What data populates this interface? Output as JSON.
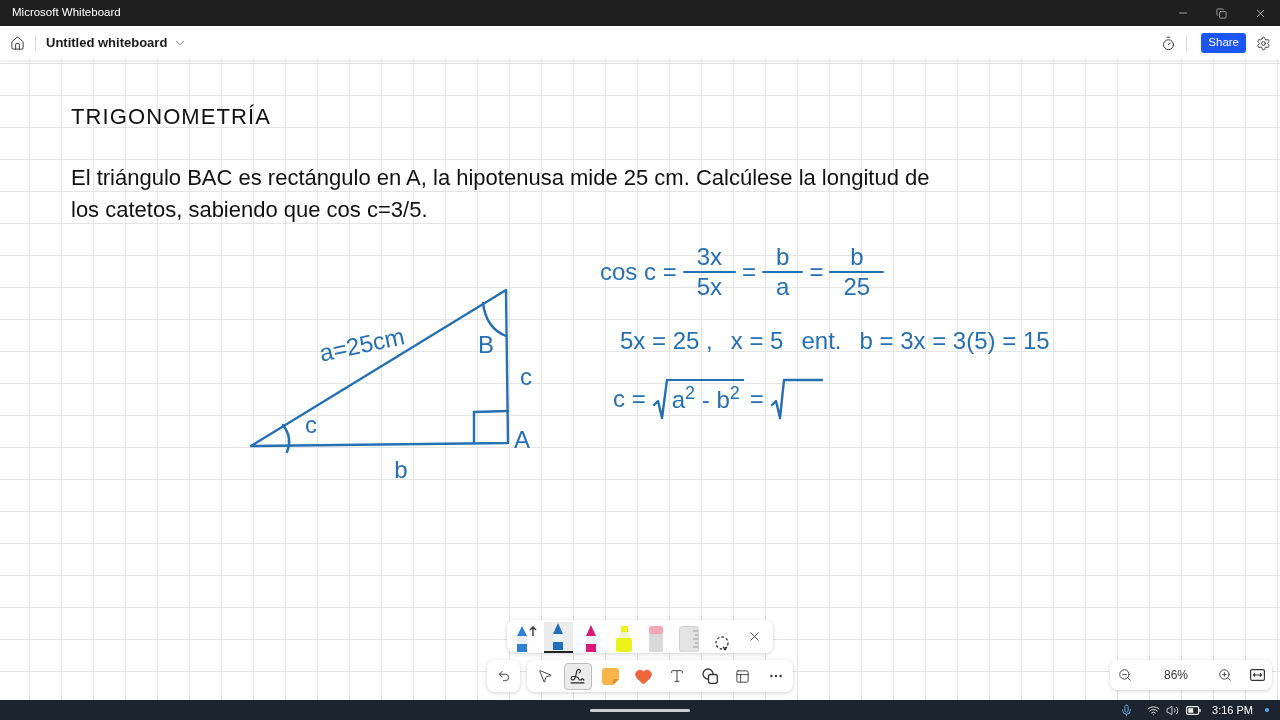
{
  "title_bar": {
    "title": "Microsoft Whiteboard"
  },
  "header": {
    "board_name": "Untitled whiteboard",
    "share": "Share"
  },
  "board": {
    "heading": "TRIGONOMETRÍA",
    "problem": "El triángulo BAC es rectángulo en A, la hipotenusa mide 25 cm. Calcúlese la longitud de los catetos, sabiendo que cos c=3/5.",
    "triangle_labels": [
      "a=25cm",
      "B",
      "c",
      "c",
      "b",
      "A"
    ],
    "ink_lines": [
      {
        "parts": [
          {
            "kind": "text",
            "text": "cos c ="
          },
          {
            "kind": "fraction",
            "numerator": "3x",
            "denominator": "5x"
          },
          {
            "kind": "text",
            "text": "="
          },
          {
            "kind": "fraction",
            "numerator": "b",
            "denominator": "a"
          },
          {
            "kind": "text",
            "text": "="
          },
          {
            "kind": "fraction",
            "numerator": "b",
            "denominator": "25"
          }
        ]
      },
      {
        "parts": [
          {
            "kind": "text",
            "text": "5x = 25 ,"
          },
          {
            "kind": "text",
            "text": "x = 5"
          },
          {
            "kind": "text",
            "text": "ent."
          },
          {
            "kind": "text",
            "text": "b = 3x = 3(5) = 15"
          }
        ]
      },
      {
        "parts": [
          {
            "kind": "text",
            "text": "c ="
          },
          {
            "kind": "sqrt",
            "radicand": "a$^{2}$ - b$^{2}$"
          },
          {
            "kind": "text",
            "text": "="
          },
          {
            "kind": "sqrt"
          }
        ]
      }
    ]
  },
  "pen_tray": [
    {
      "kind": "pen-more",
      "color": "#2f7fd6",
      "selected": false
    },
    {
      "kind": "pen",
      "color": "#1f6fbf",
      "selected": true
    },
    {
      "kind": "pen",
      "color": "#d6197a",
      "selected": false
    },
    {
      "kind": "highlighter",
      "color": "#eef21c",
      "selected": false
    },
    {
      "kind": "eraser",
      "selected": false
    },
    {
      "kind": "ruler",
      "selected": false
    },
    {
      "kind": "lasso",
      "selected": false
    }
  ],
  "toolbar": [
    {
      "kind": "select",
      "selected": false
    },
    {
      "kind": "inking",
      "selected": true
    },
    {
      "kind": "note",
      "selected": false
    },
    {
      "kind": "reactions",
      "selected": false
    },
    {
      "kind": "text",
      "selected": false
    },
    {
      "kind": "shapes",
      "selected": false
    },
    {
      "kind": "templates",
      "selected": false
    }
  ],
  "zoom": "86%",
  "taskbar": {
    "time": "3:16 PM"
  }
}
